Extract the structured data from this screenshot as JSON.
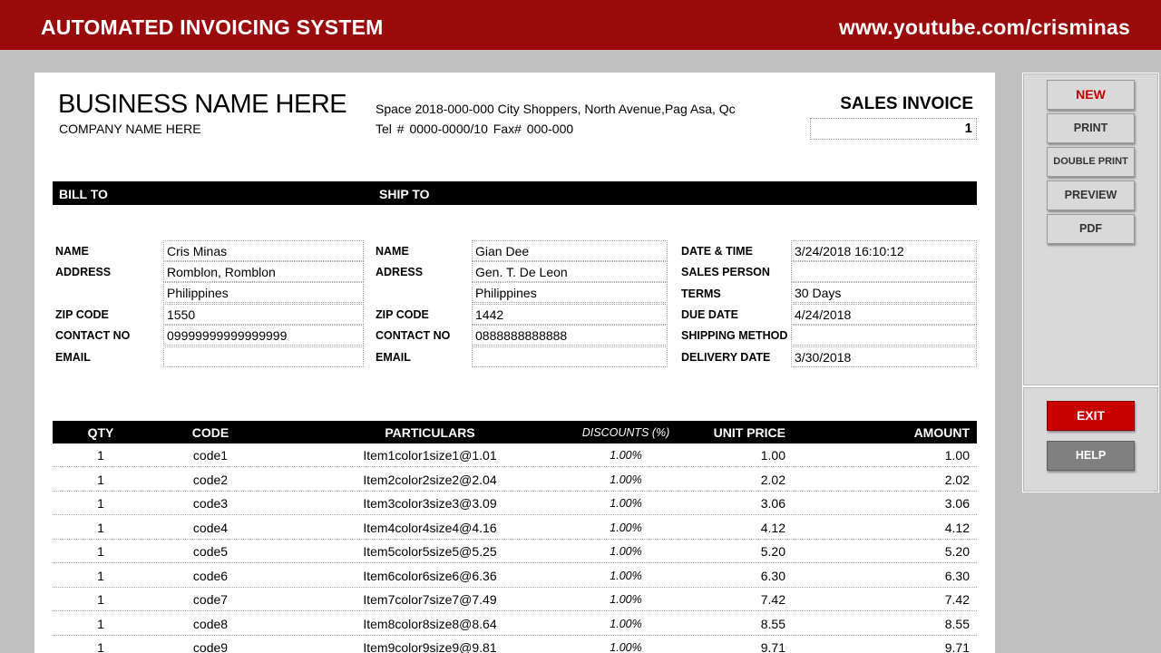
{
  "banner": {
    "title": "AUTOMATED INVOICING SYSTEM",
    "url": "www.youtube.com/crisminas"
  },
  "invoice": {
    "business_name": "BUSINESS NAME HERE",
    "company_name": "COMPANY NAME HERE",
    "address": "Space 2018-000-000 City Shoppers, North Avenue,Pag Asa, Qc",
    "tel": "Tel #  0000-0000/10  Fax#  000-000",
    "title": "SALES INVOICE",
    "number": "1"
  },
  "bar": {
    "bill_to": "BILL TO",
    "ship_to": "SHIP TO"
  },
  "bill_to": {
    "name_label": "NAME",
    "name": "Cris Minas",
    "address_label": "ADDRESS",
    "address1": "Romblon, Romblon",
    "address2": "Philippines",
    "zip_label": "ZIP CODE",
    "zip": "1550",
    "contact_label": "CONTACT NO",
    "contact": "09999999999999999",
    "email_label": "EMAIL",
    "email": ""
  },
  "ship_to": {
    "name_label": "NAME",
    "name": "Gian Dee",
    "address_label": "ADRESS",
    "address1": "Gen. T. De Leon",
    "address2": "Philippines",
    "zip_label": "ZIP CODE",
    "zip": "1442",
    "contact_label": "CONTACT NO",
    "contact": "0888888888888",
    "email_label": "EMAIL",
    "email": ""
  },
  "details": {
    "datetime_label": "DATE & TIME",
    "datetime": "3/24/2018 16:10:12",
    "salesperson_label": "SALES PERSON",
    "salesperson": "",
    "terms_label": "TERMS",
    "terms": "30 Days",
    "due_label": "DUE DATE",
    "due": "4/24/2018",
    "shipping_label": "SHIPPING METHOD",
    "shipping": "",
    "delivery_label": "DELIVERY DATE",
    "delivery": "3/30/2018"
  },
  "table": {
    "headers": {
      "qty": "QTY",
      "code": "CODE",
      "particulars": "PARTICULARS",
      "discount": "DISCOUNTS (%)",
      "unit_price": "UNIT PRICE",
      "amount": "AMOUNT"
    },
    "rows": [
      {
        "qty": "1",
        "code": "code1",
        "particulars": "Item1color1size1@1.01",
        "discount": "1.00%",
        "unit_price": "1.00",
        "amount": "1.00"
      },
      {
        "qty": "1",
        "code": "code2",
        "particulars": "Item2color2size2@2.04",
        "discount": "1.00%",
        "unit_price": "2.02",
        "amount": "2.02"
      },
      {
        "qty": "1",
        "code": "code3",
        "particulars": "Item3color3size3@3.09",
        "discount": "1.00%",
        "unit_price": "3.06",
        "amount": "3.06"
      },
      {
        "qty": "1",
        "code": "code4",
        "particulars": "Item4color4size4@4.16",
        "discount": "1.00%",
        "unit_price": "4.12",
        "amount": "4.12"
      },
      {
        "qty": "1",
        "code": "code5",
        "particulars": "Item5color5size5@5.25",
        "discount": "1.00%",
        "unit_price": "5.20",
        "amount": "5.20"
      },
      {
        "qty": "1",
        "code": "code6",
        "particulars": "Item6color6size6@6.36",
        "discount": "1.00%",
        "unit_price": "6.30",
        "amount": "6.30"
      },
      {
        "qty": "1",
        "code": "code7",
        "particulars": "Item7color7size7@7.49",
        "discount": "1.00%",
        "unit_price": "7.42",
        "amount": "7.42"
      },
      {
        "qty": "1",
        "code": "code8",
        "particulars": "Item8color8size8@8.64",
        "discount": "1.00%",
        "unit_price": "8.55",
        "amount": "8.55"
      },
      {
        "qty": "1",
        "code": "code9",
        "particulars": "Item9color9size9@9.81",
        "discount": "1.00%",
        "unit_price": "9.71",
        "amount": "9.71"
      }
    ]
  },
  "buttons": {
    "new": "NEW",
    "print": "PRINT",
    "double_print": "DOUBLE PRINT",
    "preview": "PREVIEW",
    "pdf": "PDF",
    "exit": "EXIT",
    "help": "HELP"
  },
  "colors": {
    "banner": "#9b0a0a",
    "exit": "#c80000",
    "new_text": "#c00000",
    "help": "#808080"
  }
}
